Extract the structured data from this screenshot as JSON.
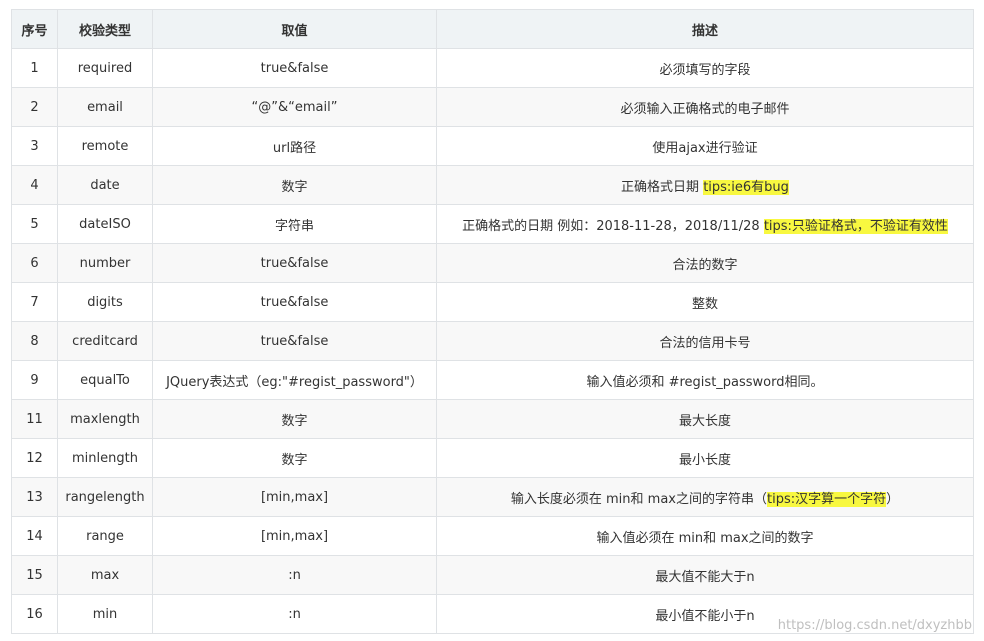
{
  "table": {
    "headers": [
      "序号",
      "校验类型",
      "取值",
      "描述"
    ],
    "rows": [
      {
        "num": "1",
        "type": "required",
        "value": "true&false",
        "desc": "必须填写的字段",
        "tip": ""
      },
      {
        "num": "2",
        "type": "email",
        "value": "“@”&“email”",
        "desc": "必须输入正确格式的电子邮件",
        "tip": ""
      },
      {
        "num": "3",
        "type": "remote",
        "value": "url路径",
        "desc": "使用ajax进行验证",
        "tip": ""
      },
      {
        "num": "4",
        "type": "date",
        "value": "数字",
        "desc": "正确格式日期 ",
        "tip": "tips:ie6有bug"
      },
      {
        "num": "5",
        "type": "dateISO",
        "value": "字符串",
        "desc": "正确格式的日期 例如：2018-11-28，2018/11/28 ",
        "tip": "tips:只验证格式，不验证有效性"
      },
      {
        "num": "6",
        "type": "number",
        "value": "true&false",
        "desc": "合法的数字",
        "tip": ""
      },
      {
        "num": "7",
        "type": "digits",
        "value": "true&false",
        "desc": "整数",
        "tip": ""
      },
      {
        "num": "8",
        "type": "creditcard",
        "value": "true&false",
        "desc": "合法的信用卡号",
        "tip": ""
      },
      {
        "num": "9",
        "type": "equalTo",
        "value": "JQuery表达式（eg:\"#regist_password\"）",
        "desc": "输入值必须和 #regist_password相同。",
        "tip": ""
      },
      {
        "num": "11",
        "type": "maxlength",
        "value": "数字",
        "desc": "最大长度",
        "tip": ""
      },
      {
        "num": "12",
        "type": "minlength",
        "value": "数字",
        "desc": "最小长度",
        "tip": ""
      },
      {
        "num": "13",
        "type": "rangelength",
        "value": "[min,max]",
        "desc": "输入长度必须在 min和 max之间的字符串（",
        "tip": "tips:汉字算一个字符",
        "desc_after": "）"
      },
      {
        "num": "14",
        "type": "range",
        "value": "[min,max]",
        "desc": "输入值必须在 min和 max之间的数字",
        "tip": ""
      },
      {
        "num": "15",
        "type": "max",
        "value": ":n",
        "desc": "最大值不能大于n",
        "tip": ""
      },
      {
        "num": "16",
        "type": "min",
        "value": ":n",
        "desc": "最小值不能小于n",
        "tip": ""
      }
    ]
  },
  "watermark": "https://blog.csdn.net/dxyzhbb",
  "colors": {
    "header_bg": "#eff3f5",
    "stripe_bg": "#f8f8f8",
    "border": "#dfe2e5",
    "highlight": "#f8f840",
    "text": "#333333"
  }
}
